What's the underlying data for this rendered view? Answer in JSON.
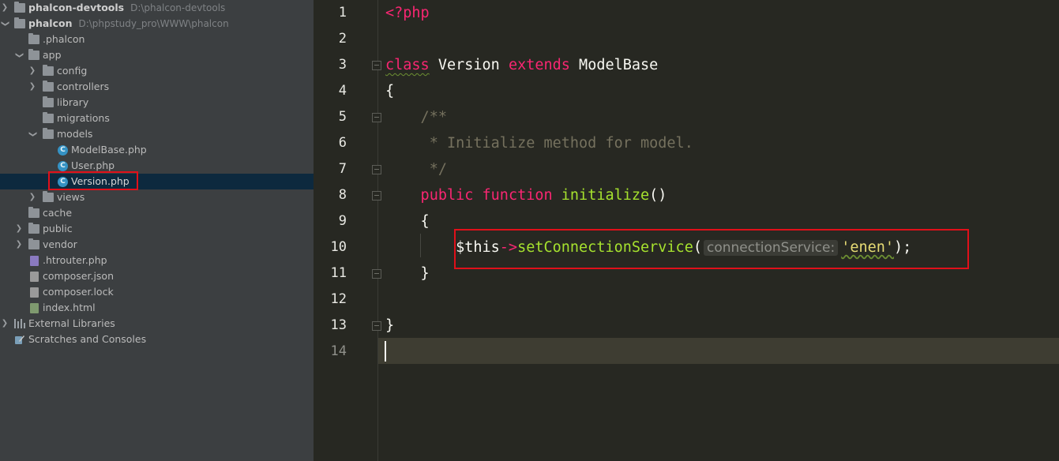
{
  "tree": {
    "root1": {
      "name": "phalcon-devtools",
      "path": "D:\\phalcon-devtools"
    },
    "root2": {
      "name": "phalcon",
      "path": "D:\\phpstudy_pro\\WWW\\phalcon"
    },
    "items": [
      {
        "label": ".phalcon"
      },
      {
        "label": "app"
      },
      {
        "label": "config"
      },
      {
        "label": "controllers"
      },
      {
        "label": "library"
      },
      {
        "label": "migrations"
      },
      {
        "label": "models"
      },
      {
        "label": "ModelBase.php"
      },
      {
        "label": "User.php"
      },
      {
        "label": "Version.php"
      },
      {
        "label": "views"
      },
      {
        "label": "cache"
      },
      {
        "label": "public"
      },
      {
        "label": "vendor"
      },
      {
        "label": ".htrouter.php"
      },
      {
        "label": "composer.json"
      },
      {
        "label": "composer.lock"
      },
      {
        "label": "index.html"
      },
      {
        "label": "External Libraries"
      },
      {
        "label": "Scratches and Consoles"
      }
    ],
    "class_letter": "C"
  },
  "editor": {
    "line_numbers": [
      "1",
      "2",
      "3",
      "4",
      "5",
      "6",
      "7",
      "8",
      "9",
      "10",
      "11",
      "12",
      "13",
      "14"
    ],
    "code": {
      "l1": "<?php",
      "l3_kw1": "class",
      "l3_name": " Version ",
      "l3_kw2": "extends",
      "l3_base": " ModelBase",
      "l4": "{",
      "l5": "    /**",
      "l6": "     * Initialize method for model.",
      "l7": "     */",
      "l8_kw1": "    public",
      "l8_kw2": " function",
      "l8_fn": " initialize",
      "l8_rest": "()",
      "l9": "    {",
      "l10_this": "        $this",
      "l10_arrow": "->",
      "l10_fn": "setConnectionService",
      "l10_open": "(",
      "l10_hint": "connectionService:",
      "l10_str": "'enen'",
      "l10_close": ");",
      "l11": "    }",
      "l13": "}"
    }
  },
  "colors": {
    "highlight_box": "#e0101a",
    "keyword": "#f92672",
    "function": "#a6e22e",
    "comment": "#75715e",
    "string": "#e6db74"
  }
}
